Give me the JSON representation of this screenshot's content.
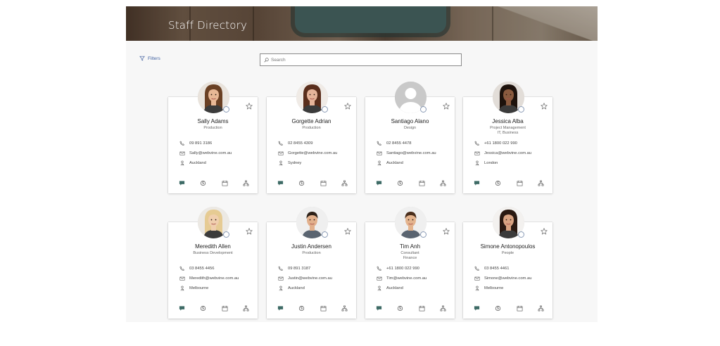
{
  "header": {
    "title": "Staff Directory"
  },
  "toolbar": {
    "filters_label": "Filters",
    "search_placeholder": "Search"
  },
  "people": [
    {
      "name": "Sally Adams",
      "dept": "Production",
      "dept2": "",
      "phone": "09 891 3186",
      "email": "Sally@webvine.com.au",
      "location": "Auckland",
      "avatar": "photo"
    },
    {
      "name": "Gorgette Adrian",
      "dept": "Production",
      "dept2": "",
      "phone": "02 8455 4309",
      "email": "Gorgette@webvine.com.au",
      "location": "Sydney",
      "avatar": "photo"
    },
    {
      "name": "Santiago Alano",
      "dept": "Design",
      "dept2": "",
      "phone": "02 8455 4478",
      "email": "Santiago@webvine.com.au",
      "location": "Auckland",
      "avatar": "placeholder"
    },
    {
      "name": "Jessica Alba",
      "dept": "Project Management",
      "dept2": "IT, Business",
      "phone": "+61 1800 022 990",
      "email": "Jessica@webvine.com.au",
      "location": "London",
      "avatar": "photo"
    },
    {
      "name": "Meredith Allen",
      "dept": "Business Development",
      "dept2": "",
      "phone": "03 8455 4456",
      "email": "Meredith@webvine.com.au",
      "location": "Melbourne",
      "avatar": "photo"
    },
    {
      "name": "Justin Andersen",
      "dept": "Production",
      "dept2": "",
      "phone": "09 891 3187",
      "email": "Justin@webvine.com.au",
      "location": "Auckland",
      "avatar": "photo"
    },
    {
      "name": "Tim Anh",
      "dept": "Consultant",
      "dept2": "Finance",
      "phone": "+61 1800 022 990",
      "email": "Tim@webvine.com.au",
      "location": "Auckland",
      "avatar": "photo"
    },
    {
      "name": "Simone Antonopoulos",
      "dept": "People",
      "dept2": "",
      "phone": "03 8455 4461",
      "email": "Simone@webvine.com.au",
      "location": "Melbourne",
      "avatar": "photo"
    }
  ],
  "icons": {
    "card_info": [
      "phone-icon",
      "mail-icon",
      "location-icon"
    ],
    "card_actions": [
      "chat-icon",
      "skype-icon",
      "calendar-icon",
      "org-chart-icon"
    ],
    "favorite": "star-icon",
    "presence": "presence-status-icon",
    "filter": "filter-icon",
    "search": "search-icon"
  },
  "colors": {
    "accent": "#4060a0",
    "presence_ring": "#8a9bb5",
    "background": "#f7f7f7"
  }
}
